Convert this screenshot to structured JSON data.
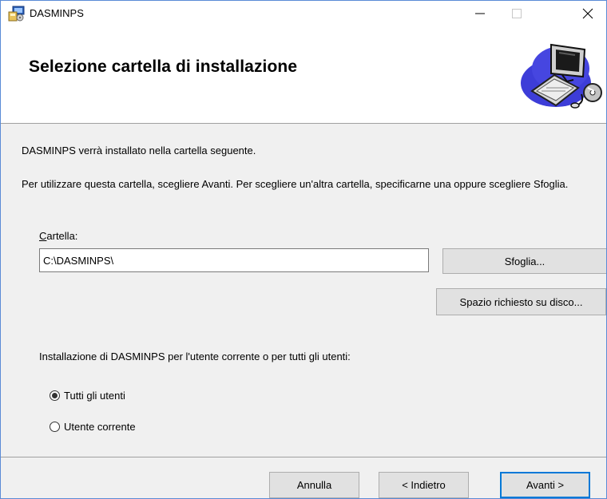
{
  "window": {
    "title": "DASMINPS"
  },
  "header": {
    "title": "Selezione cartella di installazione"
  },
  "body": {
    "intro": "DASMINPS verrà installato nella cartella seguente.",
    "description": "Per utilizzare questa cartella, scegliere Avanti. Per scegliere un'altra cartella, specificarne una oppure scegliere Sfoglia.",
    "folder_label_accel": "C",
    "folder_label_rest": "artella:",
    "folder_value": "C:\\DASMINPS\\",
    "browse_label": "Sfoglia...",
    "disk_cost_label": "Spazio richiesto su disco...",
    "install_for_label": "Installazione di DASMINPS per l'utente corrente o per tutti gli utenti:",
    "radio_all_label": "Tutti gli utenti",
    "radio_current_label": "Utente corrente",
    "selected_option": "Tutti gli utenti"
  },
  "footer": {
    "cancel_label": "Annulla",
    "back_label": "< Indietro",
    "next_label": "Avanti >"
  },
  "colors": {
    "accent": "#0078d7",
    "window_border": "#5a8bd6"
  },
  "icons": {
    "app": "installer-icon",
    "header_art": "computer-disc-icon"
  }
}
